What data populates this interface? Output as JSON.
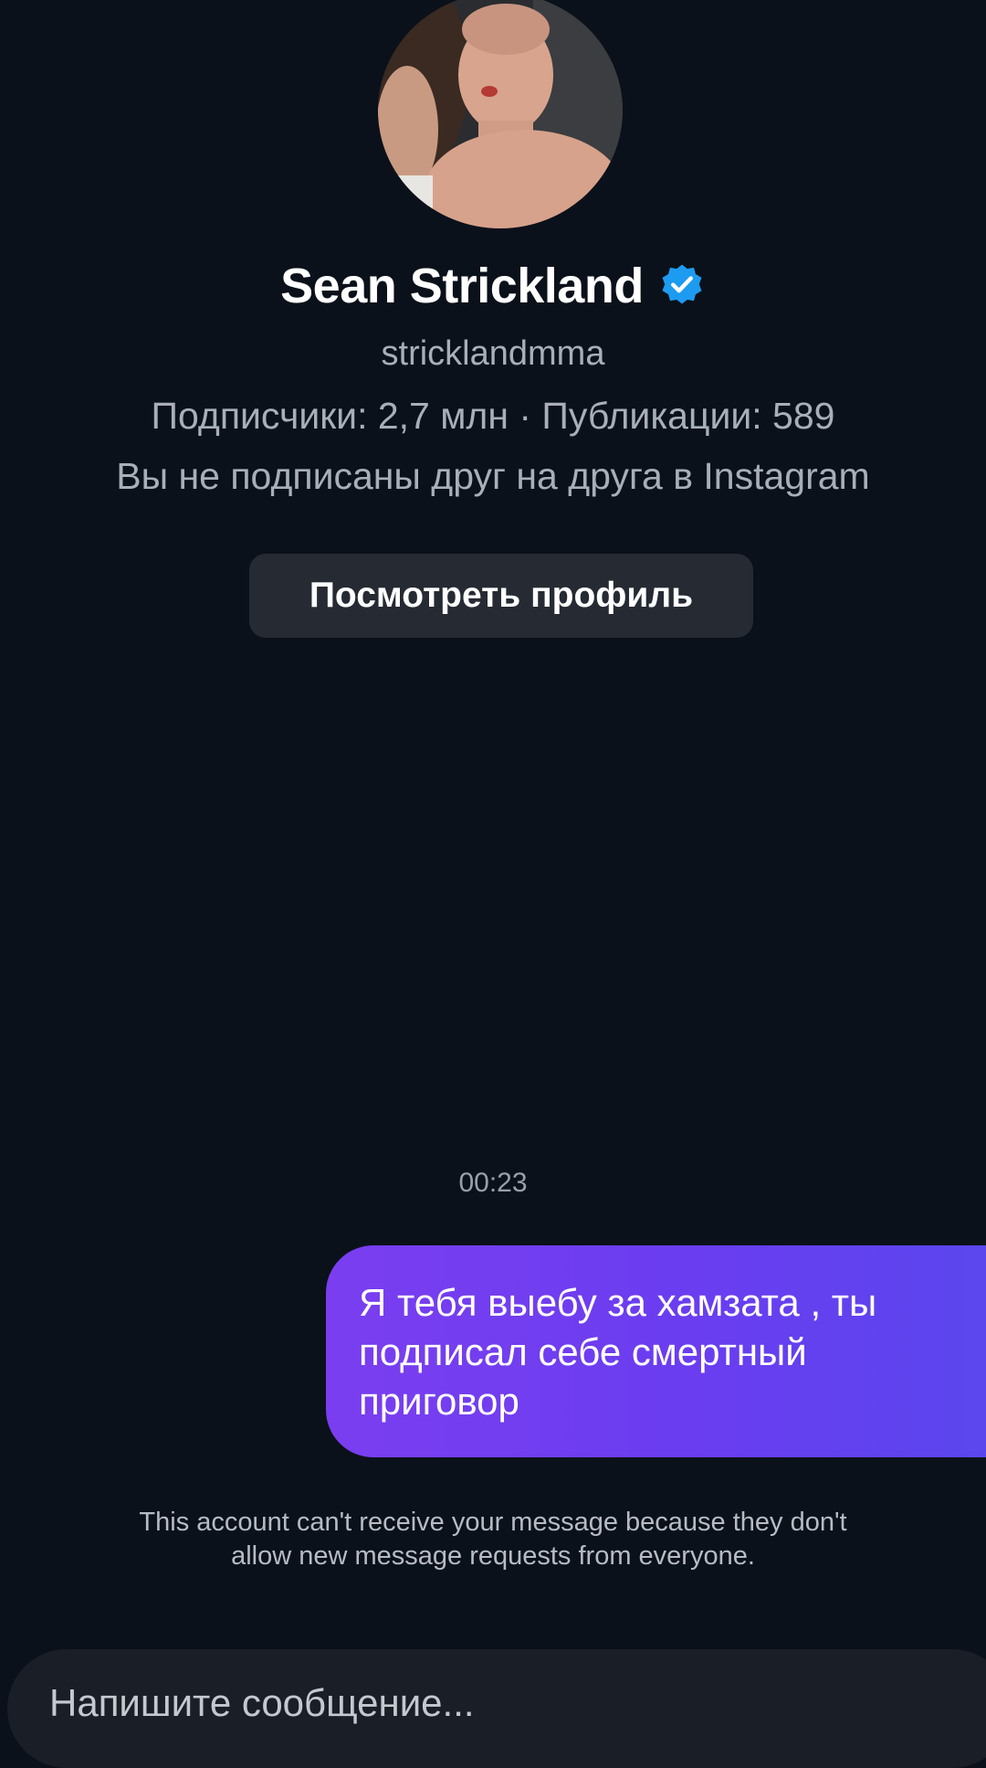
{
  "profile": {
    "display_name": "Sean Strickland",
    "verified_icon": "verified-badge-icon",
    "username": "stricklandmma",
    "stats": "Подписчики: 2,7 млн · Публикации: 589",
    "relationship": "Вы не подписаны друг на друга в Instagram",
    "view_profile_label": "Посмотреть профиль"
  },
  "conversation": {
    "timestamp": "00:23",
    "messages": [
      {
        "sender": "me",
        "text": "Я тебя выебу за хамзата , ты подписал себе смертный приговор"
      }
    ],
    "notice": "This account can't receive your message because they don't allow new message requests from everyone."
  },
  "composer": {
    "placeholder": "Напишите сообщение..."
  },
  "colors": {
    "background": "#0b111a",
    "bubble_start": "#7a3ef0",
    "bubble_end": "#5b46ee",
    "verified_blue": "#1d9bf0",
    "button_bg": "#252a33"
  }
}
